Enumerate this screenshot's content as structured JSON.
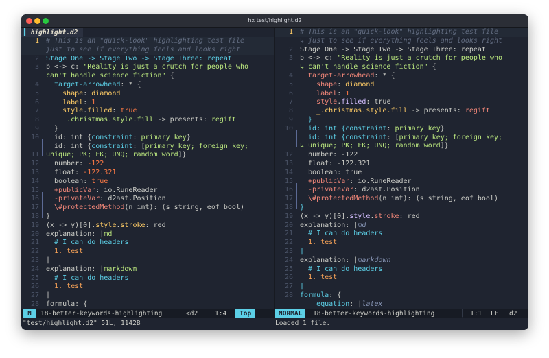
{
  "window": {
    "title": "hx test/highlight.d2"
  },
  "left_pane": {
    "buffer_tab": "highlight.d2",
    "lines": [
      {
        "n": "1",
        "current": true
      },
      {
        "n": ""
      },
      {
        "n": "2"
      },
      {
        "n": "3"
      },
      {
        "n": ""
      },
      {
        "n": "4"
      },
      {
        "n": "5"
      },
      {
        "n": "6"
      },
      {
        "n": "7"
      },
      {
        "n": "8"
      },
      {
        "n": "9"
      },
      {
        "n": "10"
      },
      {
        "n": ""
      },
      {
        "n": "11"
      },
      {
        "n": "12"
      },
      {
        "n": "13"
      },
      {
        "n": "14"
      },
      {
        "n": "15"
      },
      {
        "n": "16"
      },
      {
        "n": "17"
      },
      {
        "n": "18"
      },
      {
        "n": "19"
      },
      {
        "n": "20"
      },
      {
        "n": "21"
      },
      {
        "n": "22"
      },
      {
        "n": "23"
      },
      {
        "n": "24"
      },
      {
        "n": "25"
      },
      {
        "n": "26"
      },
      {
        "n": "27"
      },
      {
        "n": "28"
      }
    ],
    "text": {
      "l1": "# This is an \"quick-look\" highlighting test file",
      "l1b": "just to see if everything feels and looks right",
      "l2": "Stage One -> Stage Two -> Stage Three: repeat",
      "l3a": "b <-> c: ",
      "l3b": "\"Reality is just a crutch for people who",
      "l3c": "can't handle science fiction\"",
      "l3d": " {",
      "l4a": "  target-arrowhead",
      "l4b": ": * {",
      "l5a": "    shape",
      "l5b": ": ",
      "l5c": "diamond",
      "l6a": "    label",
      "l6b": ": ",
      "l6c": "1",
      "l7a": "    style",
      "l7b": ".",
      "l7c": "filled",
      "l7d": ": ",
      "l7e": "true",
      "l8a": "    _",
      "l8b": ".christmas.style.fill",
      "l8c": " -> presents: ",
      "l8d": "regift",
      "l9": "  }",
      "l10a": "  id: int {",
      "l10b": "constraint",
      "l10c": ": ",
      "l10d": "primary_key",
      "l10e": "}",
      "l11a": "  id: int {",
      "l11b": "constraint",
      "l11c": ": [",
      "l11d": "primary_key; foreign_key;",
      "l11e": "unique; PK; FK; UNQ; random word",
      "l11f": "]}",
      "l12a": "  number",
      "l12b": ": ",
      "l12c": "-122",
      "l13a": "  float",
      "l13b": ": ",
      "l13c": "-122.321",
      "l14a": "  boolean",
      "l14b": ": ",
      "l14c": "true",
      "l15a": "  +publicVar",
      "l15b": ": ",
      "l15c": "io.RuneReader",
      "l16a": "  -privateVar",
      "l16b": ": ",
      "l16c": "d2ast.Position",
      "l17a": "  \\#protectedMethod",
      "l17b": "(n int): (s string, eof bool)",
      "l18": "}",
      "l19a": "(x -> y)[0].",
      "l19b": "style",
      "l19c": ".",
      "l19d": "stroke",
      "l19e": ": ",
      "l19f": "red",
      "l20a": "explanation",
      "l20b": ": |",
      "l20c": "md",
      "l21": "  # I can do headers",
      "l22": "  1. test",
      "l23": "|",
      "l24a": "explanation",
      "l24b": ": |",
      "l24c": "markdown",
      "l25": "  # I can do headers",
      "l26": "  1. test",
      "l27": "|",
      "l28a": "formula",
      "l28b": ": {"
    }
  },
  "right_pane": {
    "text": {
      "l1": "# This is an \"quick-look\" highlighting test file",
      "l1b": "↳ just to see if everything feels and looks right",
      "l2": "Stage One -> Stage Two -> Stage Three: repeat",
      "l3a": "b <-> c: ",
      "l3b": "\"Reality is just a crutch for people who",
      "l3c": "↳ can't handle science fiction\"",
      "l3d": " {",
      "l4a": "  target-arrowhead",
      "l4b": ": * {",
      "l5a": "    shape",
      "l5b": ": ",
      "l5c": "diamond",
      "l6a": "    label",
      "l6b": ": ",
      "l6c": "1",
      "l7a": "    style",
      "l7b": ".",
      "l7c": "filled",
      "l7d": ": ",
      "l7e": "true",
      "l8a": "    _",
      "l8b": ".christmas.style.fill",
      "l8c": " -> presents: ",
      "l8d": "regift",
      "l9": "  }",
      "l10a": "  id: int {",
      "l10b": "constraint",
      "l10c": ": ",
      "l10d": "primary_key",
      "l10e": "}",
      "l11a": "  id: int {",
      "l11b": "constraint",
      "l11c": ": [",
      "l11d": "primary_key; foreign_key;",
      "l11e": "↳ unique; PK; FK; UNQ; random word",
      "l11f": "]}",
      "l12a": "  number",
      "l12b": ": ",
      "l12c": "-122",
      "l13a": "  float",
      "l13b": ": ",
      "l13c": "-122.321",
      "l14a": "  boolean",
      "l14b": ": ",
      "l14c": "true",
      "l15a": "  +publicVar",
      "l15b": ": ",
      "l15c": "io.RuneReader",
      "l16a": "  -privateVar",
      "l16b": ": ",
      "l16c": "d2ast.Position",
      "l17a": "  \\#protectedMethod",
      "l17b": "(n int): (s string, eof bool)",
      "l18": "}",
      "l19a": "(x -> y)[0].",
      "l19b": "style",
      "l19c": ".",
      "l19d": "stroke",
      "l19e": ": ",
      "l19f": "red",
      "l20a": "explanation",
      "l20b": ": |",
      "l20c": "md",
      "l21": "  # I can do headers",
      "l22": "  1. test",
      "l23": "|",
      "l24a": "explanation",
      "l24b": ": |",
      "l24c": "markdown",
      "l25": "  # I can do headers",
      "l26": "  1. test",
      "l27": "|",
      "l28a": "formula",
      "l28b": ": {",
      "l29a": "    equation",
      "l29b": ": |",
      "l29c": "latex"
    }
  },
  "status_left": {
    "mode": "N",
    "branch": "18-better-keywords-highlighting",
    "lang": "<d2",
    "position": "1:4",
    "scroll": "Top"
  },
  "status_right": {
    "mode": "NORMAL",
    "branch": "18-better-keywords-highlighting",
    "position": "1:1",
    "eol": "LF",
    "lang": "d2"
  },
  "cmdline": {
    "left": "\"test/highlight.d2\" 51L, 1142B",
    "right": "Loaded 1 file."
  },
  "colors": {
    "background": "#1f2430",
    "comment": "#626c80",
    "keyword": "#ffa759",
    "string": "#bae67e",
    "number": "#ff7a45",
    "accent": "#5ccfe6"
  }
}
